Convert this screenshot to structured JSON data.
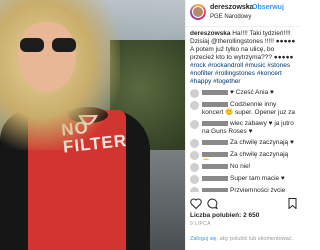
{
  "header": {
    "username": "dereszowska",
    "separator": "•",
    "follow_label": "Obserwuj",
    "location": "PGE Narodowy"
  },
  "caption": {
    "username": "dereszowska",
    "text": "Ha!!!! Taki tydzień!!!! Dzisiaj @therollingstones !!!!! ●●●●● A potem już tylko na ulicę, bo przecież kto to wytrzyma??? ●●●●●",
    "hashtags": "#rock #rockandroll #music #stones #nofilter #rollingstones #koncert #happy #together"
  },
  "comments": [
    {
      "text": "♥ Cześć Ania ♥",
      "short": true
    },
    {
      "text": "Codziennie inny koncert 🙂 super. Opener juz za nami !",
      "short": false
    },
    {
      "text": "wiec zabawy ♥ ja jutro na Guns Roses ♥",
      "short": false
    },
    {
      "text": "Za chwilę zaczynają ♥",
      "short": true
    },
    {
      "text": "Za chwilę zaczynają 🙂",
      "short": true
    },
    {
      "text": "No nie!",
      "short": true
    },
    {
      "text": "Super tam macie ♥",
      "short": true
    },
    {
      "text": "Przyjemności życie ♥♥♥",
      "short": true
    }
  ],
  "likes_text": "Liczba polubień: 2 650",
  "date_text": "9 LIPCA",
  "login_prompt": {
    "link": "Zaloguj się",
    "text": ", aby polubić lub skomentować."
  },
  "photo": {
    "shirt_text": "NO FILTER"
  },
  "icons": [
    "heart-icon",
    "comment-icon",
    "bookmark-icon",
    "more-icon"
  ],
  "colors": {
    "accent": "#3897f0",
    "text": "#262626",
    "muted": "#999999",
    "shirt": "#d2352f"
  }
}
